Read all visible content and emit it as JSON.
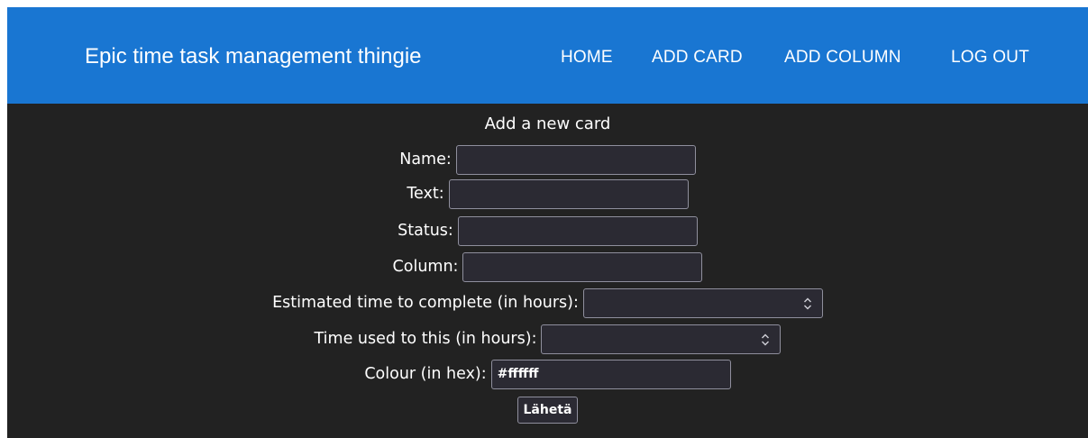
{
  "header": {
    "title": "Epic time task management thingie",
    "nav": [
      "HOME",
      "ADD CARD",
      "ADD COLUMN",
      "LOG OUT"
    ]
  },
  "form": {
    "heading": "Add a new card",
    "name_label": "Name:",
    "name_value": "",
    "text_label": "Text:",
    "text_value": "",
    "status_label": "Status:",
    "status_value": "",
    "column_label": "Column:",
    "column_value": "",
    "estimated_label": "Estimated time to complete (in hours):",
    "used_label": "Time used to this (in hours):",
    "colour_label": "Colour (in hex):",
    "colour_value": "#ffffff",
    "submit_label": "Lähetä"
  },
  "colors": {
    "header_bg": "#1976d2",
    "page_bg": "#222222",
    "input_bg": "#2b2a33"
  }
}
